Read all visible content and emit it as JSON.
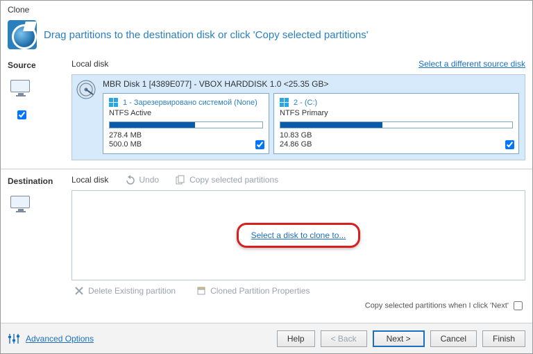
{
  "window": {
    "title": "Clone"
  },
  "banner": {
    "text": "Drag partitions to the destination disk or click 'Copy selected partitions'"
  },
  "source": {
    "label": "Source",
    "local_disk": "Local disk",
    "select_diff_link": "Select a different source disk",
    "disk_title": "MBR Disk 1 [4389E077] - VBOX HARDDISK 1.0  <25.35 GB>",
    "partitions": [
      {
        "name": "1 - Зарезервировано системой (None)",
        "type": "NTFS Active",
        "used": "278.4 MB",
        "total": "500.0 MB",
        "fill_pct": 56
      },
      {
        "name": "2 -  (C:)",
        "type": "NTFS Primary",
        "used": "10.83 GB",
        "total": "24.86 GB",
        "fill_pct": 44
      }
    ]
  },
  "destination": {
    "label": "Destination",
    "local_disk": "Local disk",
    "undo": "Undo",
    "copy_selected": "Copy selected partitions",
    "select_link": "Select a disk to clone to...",
    "delete_existing": "Delete Existing partition",
    "cloned_props": "Cloned Partition Properties",
    "bottom_note": "Copy selected partitions when I click 'Next'"
  },
  "footer": {
    "advanced": "Advanced Options",
    "help": "Help",
    "back": "< Back",
    "next": "Next >",
    "cancel": "Cancel",
    "finish": "Finish"
  }
}
